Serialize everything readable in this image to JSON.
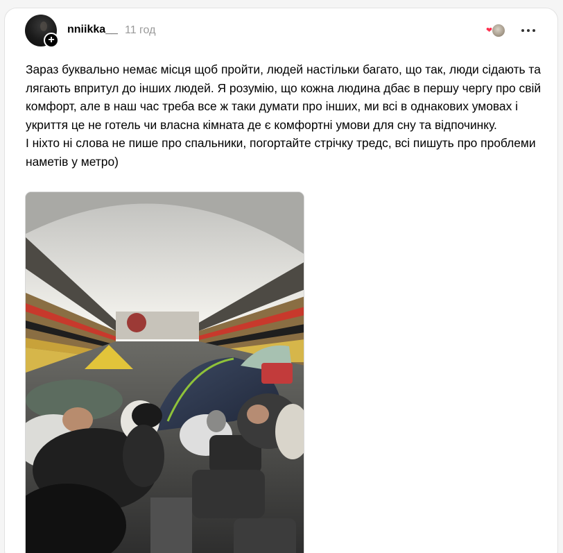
{
  "post": {
    "username": "nniikka__",
    "time_ago": "11 год",
    "text": "Зараз буквально немає місця щоб пройти, людей настільки багато, що так, люди сідають та лягають впритул до інших людей. Я розумію, що кожна людина дбає в першу чергу про свій комфорт, але в наш час треба все ж таки думати про інших, ми всі в однакових умовах і укриття це не готель чи власна кімната де є комфортні умови для сну та відпочинку.\nІ ніхто ні слова не пише про спальники, погортайте стрічку тредс, всі пишуть про проблеми наметів у метро)",
    "follow_badge": "+"
  },
  "icons": {
    "follow": "plus-icon",
    "heart": "heart-icon",
    "more": "more-horizontal-icon"
  },
  "colors": {
    "background": "#f5f5f5",
    "card": "#ffffff",
    "secondary_text": "#999999",
    "heart": "#ff2e4d"
  }
}
